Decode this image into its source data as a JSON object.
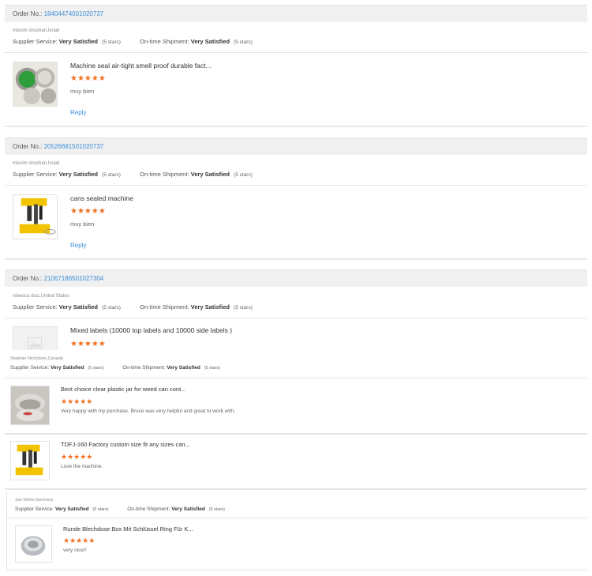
{
  "labels": {
    "order_no": "Order No.:",
    "supplier_service": "Supplier Service:",
    "ontime_shipment": "On-time Shipment:",
    "reply": "Reply"
  },
  "reviews": [
    {
      "order_no": "18404474001020737",
      "buyer": "missim shushan,Israel",
      "supplier_service": "Very Satisfied",
      "supplier_stars": "(5 stars)",
      "ontime_shipment": "Very Satisfied",
      "ontime_stars": "(5 stars)",
      "product_title": "Machine seal air-tight smell proof durable fact...",
      "rating": "★★★★★",
      "comment": "muy bien"
    },
    {
      "order_no": "20526691501020737",
      "buyer": "missim shushan,Israel",
      "supplier_service": "Very Satisfied",
      "supplier_stars": "(5 stars)",
      "ontime_shipment": "Very Satisfied",
      "ontime_stars": "(5 stars)",
      "product_title": "cans sealed machine",
      "rating": "★★★★★",
      "comment": "muy bien"
    },
    {
      "order_no": "21067186501027304",
      "buyer": "rebecca diaz,United States",
      "supplier_service": "Very Satisfied",
      "supplier_stars": "(5 stars)",
      "ontime_shipment": "Very Satisfied",
      "ontime_stars": "(5 stars)",
      "product_title": "Mixed labels (10000 top labels and 10000 side labels )",
      "rating": "★★★★★"
    },
    {
      "buyer": "Stephan Nicholson,Canada",
      "supplier_service": "Very Satisfied",
      "supplier_stars": "(5 stars)",
      "ontime_shipment": "Very Satisfied",
      "ontime_stars": "(5 stars)",
      "products": [
        {
          "product_title": "Best choice clear plastic jar for weed can cont...",
          "rating": "★★★★★",
          "comment": "Very happy with my purchase. Bruce was very helpful and great to work with."
        },
        {
          "product_title": "TDFJ-160 Factory custom size fit any sizes can...",
          "rating": "★★★★★",
          "comment": "Love the machine."
        }
      ]
    },
    {
      "buyer": "Jan Klehn,Germany",
      "supplier_service": "Very Satisfied",
      "supplier_stars": "(5 stars)",
      "ontime_shipment": "Very Satisfied",
      "ontime_stars": "(5 stars)",
      "product_title": "Runde Blechdose Box Mit Schlüssel Ring Für K...",
      "rating": "★★★★★",
      "comment": "very nice!!"
    }
  ],
  "colors": {
    "link": "#3c8fd8",
    "star": "#f07020",
    "header_bg": "#f0f0f0"
  }
}
